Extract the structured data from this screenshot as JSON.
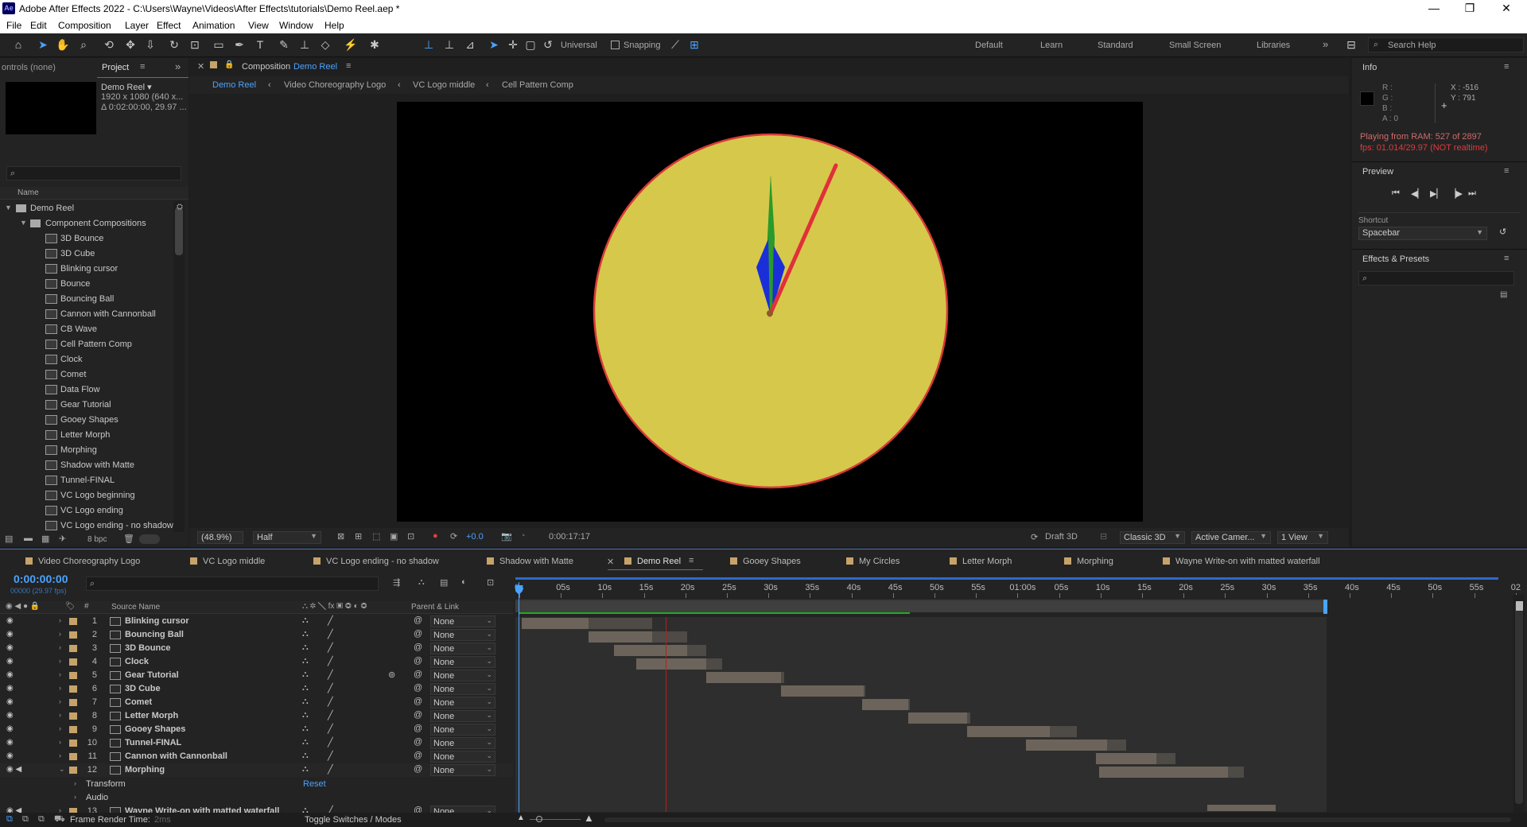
{
  "window": {
    "title": "Adobe After Effects 2022 - C:\\Users\\Wayne\\Videos\\After Effects\\tutorials\\Demo Reel.aep *",
    "logo": "Ae",
    "minimize": "—",
    "maximize": "❐",
    "close": "✕"
  },
  "menu": [
    "File",
    "Edit",
    "Composition",
    "Layer",
    "Effect",
    "Animation",
    "View",
    "Window",
    "Help"
  ],
  "toolbar": {
    "universal": "Universal",
    "snapping": "Snapping",
    "workspaces": [
      "Default",
      "Learn",
      "Standard",
      "Small Screen",
      "Libraries"
    ],
    "more": "»",
    "search_placeholder": "Search Help"
  },
  "project": {
    "controls_label": "ontrols (none)",
    "tab": "Project",
    "preview_name": "Demo Reel ▾",
    "preview_info1": "1920 x 1080 (640 x...",
    "preview_info2": "Δ 0:02:00:00, 29.97 ...",
    "search_placeholder": "",
    "col_name": "Name",
    "root": "Demo Reel",
    "folder": "Component Compositions",
    "items": [
      "3D Bounce",
      "3D Cube",
      "Blinking cursor",
      "Bounce",
      "Bouncing Ball",
      "Cannon with Cannonball",
      "CB Wave",
      "Cell Pattern Comp",
      "Clock",
      "Comet",
      "Data Flow",
      "Gear Tutorial",
      "Gooey Shapes",
      "Letter Morph",
      "Morphing",
      "Shadow with Matte",
      "Tunnel-FINAL",
      "VC Logo beginning",
      "VC Logo ending",
      "VC Logo ending - no shadow"
    ],
    "bpc": "8 bpc"
  },
  "composition": {
    "tab_prefix": "Composition",
    "tab_name": "Demo Reel",
    "breadcrumbs": [
      "Demo Reel",
      "Video Choreography Logo",
      "VC Logo middle",
      "Cell Pattern Comp"
    ],
    "zoom": "(48.9%)",
    "resolution": "Half",
    "exposure": "+0.0",
    "timecode": "0:00:17:17",
    "draft3d": "Draft 3D",
    "renderer": "Classic 3D",
    "camera": "Active Camer...",
    "views": "1 View",
    "colors": {
      "face": "#d6c84a",
      "rim": "#d83a3a",
      "hand_red": "#e0303a",
      "hand_green": "#2a9a2a",
      "hand_blue": "#1a2fd8"
    }
  },
  "info": {
    "title": "Info",
    "r": "R :",
    "g": "G :",
    "b": "B :",
    "a": "A :  0",
    "x": "X : -516",
    "y": "Y : 791",
    "playing": "Playing from RAM: 527 of 2897",
    "fps": "fps: 01.014/29.97 (NOT realtime)"
  },
  "preview": {
    "title": "Preview",
    "shortcut_label": "Shortcut",
    "shortcut_value": "Spacebar"
  },
  "effects": {
    "title": "Effects & Presets",
    "search_placeholder": ""
  },
  "timeline": {
    "tabs": [
      "Video Choreography Logo",
      "VC Logo middle",
      "VC Logo ending - no shadow",
      "Shadow with Matte",
      "Demo Reel",
      "Gooey Shapes",
      "My Circles",
      "Letter Morph",
      "Morphing",
      "Wayne Write-on with matted waterfall"
    ],
    "active_tab": "Demo Reel",
    "timecode": "0:00:00:00",
    "frame_info": "00000 (29.97 fps)",
    "col_source": "Source Name",
    "col_parent": "Parent & Link",
    "ruler": [
      "0s",
      "05s",
      "10s",
      "15s",
      "20s",
      "25s",
      "30s",
      "35s",
      "40s",
      "45s",
      "50s",
      "55s",
      "01:00s",
      "05s",
      "10s",
      "15s",
      "20s",
      "25s",
      "30s",
      "35s",
      "40s",
      "45s",
      "50s",
      "55s",
      "02"
    ],
    "layers": [
      {
        "num": "1",
        "name": "Blinking cursor",
        "parent": "None"
      },
      {
        "num": "2",
        "name": "Bouncing Ball",
        "parent": "None"
      },
      {
        "num": "3",
        "name": "3D Bounce",
        "parent": "None"
      },
      {
        "num": "4",
        "name": "Clock",
        "parent": "None"
      },
      {
        "num": "5",
        "name": "Gear Tutorial",
        "parent": "None"
      },
      {
        "num": "6",
        "name": "3D Cube",
        "parent": "None"
      },
      {
        "num": "7",
        "name": "Comet",
        "parent": "None"
      },
      {
        "num": "8",
        "name": "Letter Morph",
        "parent": "None"
      },
      {
        "num": "9",
        "name": "Gooey Shapes",
        "parent": "None"
      },
      {
        "num": "10",
        "name": "Tunnel-FINAL",
        "parent": "None"
      },
      {
        "num": "11",
        "name": "Cannon with Cannonball",
        "parent": "None"
      },
      {
        "num": "12",
        "name": "Morphing",
        "parent": "None"
      },
      {
        "num": "13",
        "name": "Wayne Write-on with matted waterfall",
        "parent": "None"
      }
    ],
    "transform": "Transform",
    "reset": "Reset",
    "audio": "Audio",
    "render_time_label": "Frame Render Time:",
    "render_time": "2ms",
    "toggle": "Toggle Switches / Modes"
  }
}
